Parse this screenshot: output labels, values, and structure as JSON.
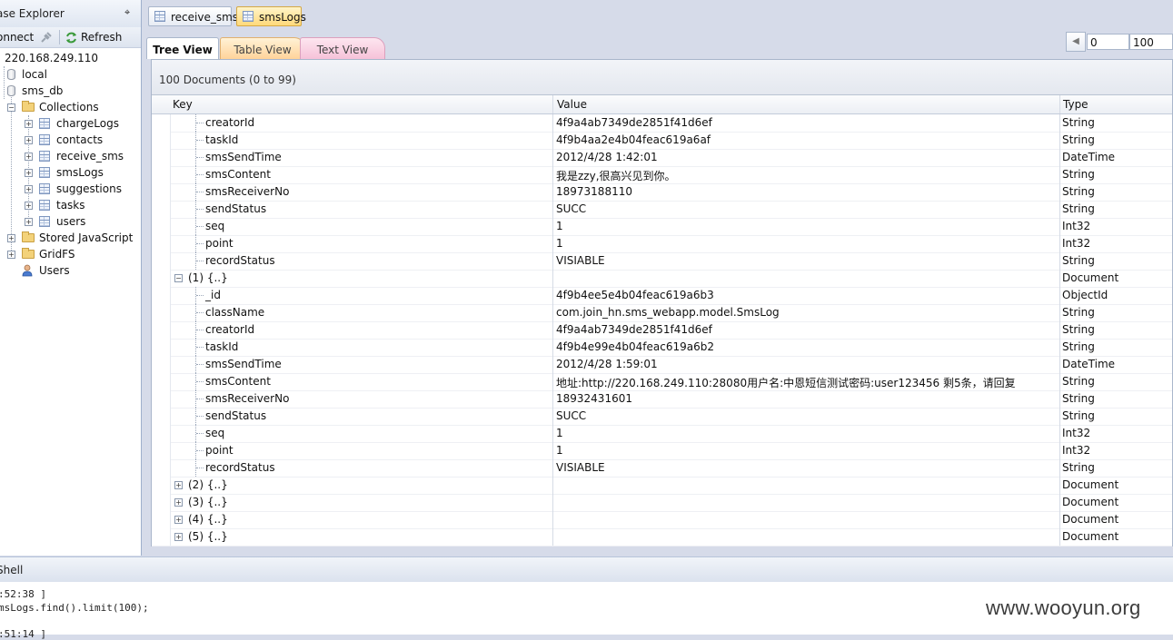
{
  "explorer": {
    "title": "ase Explorer",
    "pin_glyph": "⌖",
    "toolbar": {
      "connect_label": "onnect",
      "refresh_label": "Refresh"
    },
    "server": "220.168.249.110",
    "databases": [
      {
        "label": "local"
      },
      {
        "label": "sms_db"
      }
    ],
    "collections_label": "Collections",
    "collections": [
      "chargeLogs",
      "contacts",
      "receive_sms",
      "smsLogs",
      "suggestions",
      "tasks",
      "users"
    ],
    "stored_js_label": "Stored JavaScript",
    "gridfs_label": "GridFS",
    "users_label": "Users"
  },
  "doc_tabs": [
    {
      "label": "receive_sms",
      "active": false
    },
    {
      "label": "smsLogs",
      "active": true
    }
  ],
  "view_tabs": {
    "tree": "Tree View",
    "table": "Table View",
    "text": "Text View"
  },
  "paging": {
    "skip": "0",
    "limit": "100"
  },
  "doc_count": "100 Documents (0 to 99)",
  "grid": {
    "headers": {
      "key": "Key",
      "value": "Value",
      "type": "Type"
    },
    "rows": [
      {
        "key": "creatorId",
        "value": "4f9a4ab7349de2851f41d6ef",
        "type": "String"
      },
      {
        "key": "taskId",
        "value": "4f9b4aa2e4b04feac619a6af",
        "type": "String"
      },
      {
        "key": "smsSendTime",
        "value": "2012/4/28 1:42:01",
        "type": "DateTime"
      },
      {
        "key": "smsContent",
        "value": "我是zzy,很高兴见到你。",
        "type": "String"
      },
      {
        "key": "smsReceiverNo",
        "value": "18973188110",
        "type": "String"
      },
      {
        "key": "sendStatus",
        "value": "SUCC",
        "type": "String"
      },
      {
        "key": "seq",
        "value": "1",
        "type": "Int32"
      },
      {
        "key": "point",
        "value": "1",
        "type": "Int32"
      },
      {
        "key": "recordStatus",
        "value": "VISIABLE",
        "type": "String"
      },
      {
        "key": "(1) {..}",
        "value": "",
        "type": "Document",
        "doc": true,
        "open": true
      },
      {
        "key": "_id",
        "value": "4f9b4ee5e4b04feac619a6b3",
        "type": "ObjectId"
      },
      {
        "key": "className",
        "value": "com.join_hn.sms_webapp.model.SmsLog",
        "type": "String"
      },
      {
        "key": "creatorId",
        "value": "4f9a4ab7349de2851f41d6ef",
        "type": "String"
      },
      {
        "key": "taskId",
        "value": "4f9b4e99e4b04feac619a6b2",
        "type": "String"
      },
      {
        "key": "smsSendTime",
        "value": "2012/4/28 1:59:01",
        "type": "DateTime"
      },
      {
        "key": "smsContent",
        "value": "地址:http://220.168.249.110:28080用户名:中恩短信测试密码:user123456 剩5条，请回复",
        "type": "String"
      },
      {
        "key": "smsReceiverNo",
        "value": "18932431601",
        "type": "String"
      },
      {
        "key": "sendStatus",
        "value": "SUCC",
        "type": "String"
      },
      {
        "key": "seq",
        "value": "1",
        "type": "Int32"
      },
      {
        "key": "point",
        "value": "1",
        "type": "Int32"
      },
      {
        "key": "recordStatus",
        "value": "VISIABLE",
        "type": "String"
      },
      {
        "key": "(2) {..}",
        "value": "",
        "type": "Document",
        "doc": true,
        "open": false
      },
      {
        "key": "(3) {..}",
        "value": "",
        "type": "Document",
        "doc": true,
        "open": false
      },
      {
        "key": "(4) {..}",
        "value": "",
        "type": "Document",
        "doc": true,
        "open": false
      },
      {
        "key": "(5) {..}",
        "value": "",
        "type": "Document",
        "doc": true,
        "open": false
      }
    ]
  },
  "shell": {
    "title": "Shell",
    "lines": [
      ":52:38 ]",
      "msLogs.find().limit(100);",
      "",
      ":51:14 ]"
    ]
  },
  "watermark": "www.wooyun.org"
}
